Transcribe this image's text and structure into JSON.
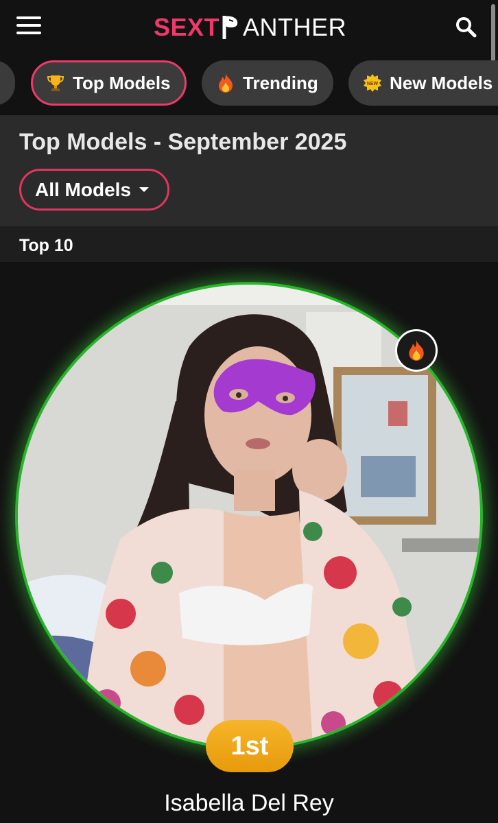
{
  "header": {
    "logo_left": "SEXT",
    "logo_right": "ANTHER",
    "menu_icon": "hamburger-menu-icon",
    "search_icon": "search-icon",
    "brand_color": "#f0386b"
  },
  "tabs": [
    {
      "label": "",
      "icon": "partial-tab",
      "active": false
    },
    {
      "label": "Top Models",
      "icon": "trophy-icon",
      "active": true
    },
    {
      "label": "Trending",
      "icon": "fire-icon",
      "active": false
    },
    {
      "label": "New Models",
      "icon": "new-badge-icon",
      "active": false
    }
  ],
  "main": {
    "title": "Top Models - September 2025",
    "filter_label": "All Models",
    "section_label": "Top 10"
  },
  "model": {
    "rank": "1st",
    "name": "Isabella Del Rey",
    "hot_icon": "fire-icon",
    "ring_color": "#27b52a",
    "rank_color": "#f0a31b"
  }
}
